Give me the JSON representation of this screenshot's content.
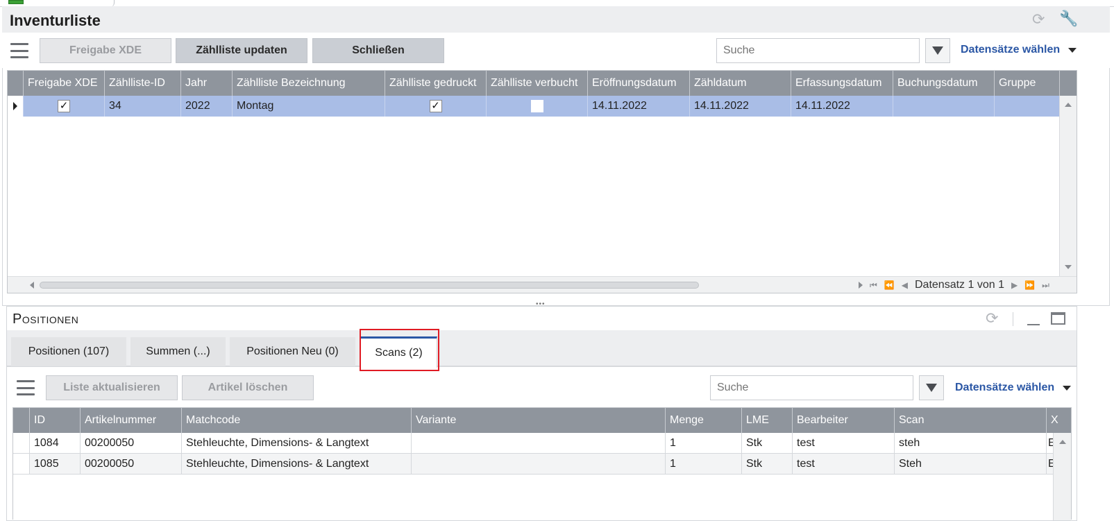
{
  "header": {
    "title": "Inventurliste"
  },
  "toolbar1": {
    "btn_freigabe": "Freigabe XDE",
    "btn_update": "Zählliste updaten",
    "btn_close": "Schließen",
    "search_placeholder": "Suche",
    "records_label": "Datensätze wählen"
  },
  "grid1": {
    "columns": [
      "Freigabe XDE",
      "Zählliste-ID",
      "Jahr",
      "Zählliste Bezeichnung",
      "Zählliste gedruckt",
      "Zählliste verbucht",
      "Eröffnungsdatum",
      "Zähldatum",
      "Erfassungsdatum",
      "Buchungsdatum",
      "Gruppe"
    ],
    "row": {
      "id": "34",
      "jahr": "2022",
      "bezeichnung": "Montag",
      "eroeffnung": "14.11.2022",
      "zaehldatum": "14.11.2022",
      "erfassung": "14.11.2022",
      "buchung": "",
      "gruppe": ""
    },
    "pager_text": "Datensatz 1 von 1"
  },
  "panel2": {
    "title": "Positionen",
    "tabs": [
      "Positionen (107)",
      "Summen (...)",
      "Positionen Neu (0)",
      "Scans (2)"
    ],
    "btn_refresh": "Liste aktualisieren",
    "btn_delete": "Artikel löschen",
    "search_placeholder": "Suche",
    "records_label": "Datensätze wählen"
  },
  "grid2": {
    "columns": [
      "ID",
      "Artikelnummer",
      "Matchcode",
      "Variante",
      "Menge",
      "LME",
      "Bearbeiter",
      "Scan",
      "X"
    ],
    "rows": [
      {
        "id": "1084",
        "artikel": "00200050",
        "matchcode": "Stehleuchte, Dimensions- & Langtext",
        "variante": "",
        "menge": "1",
        "lme": "Stk",
        "bearbeiter": "test",
        "scan": "steh",
        "x": "E"
      },
      {
        "id": "1085",
        "artikel": "00200050",
        "matchcode": "Stehleuchte, Dimensions- & Langtext",
        "variante": "",
        "menge": "1",
        "lme": "Stk",
        "bearbeiter": "test",
        "scan": "Steh",
        "x": "E"
      }
    ]
  }
}
